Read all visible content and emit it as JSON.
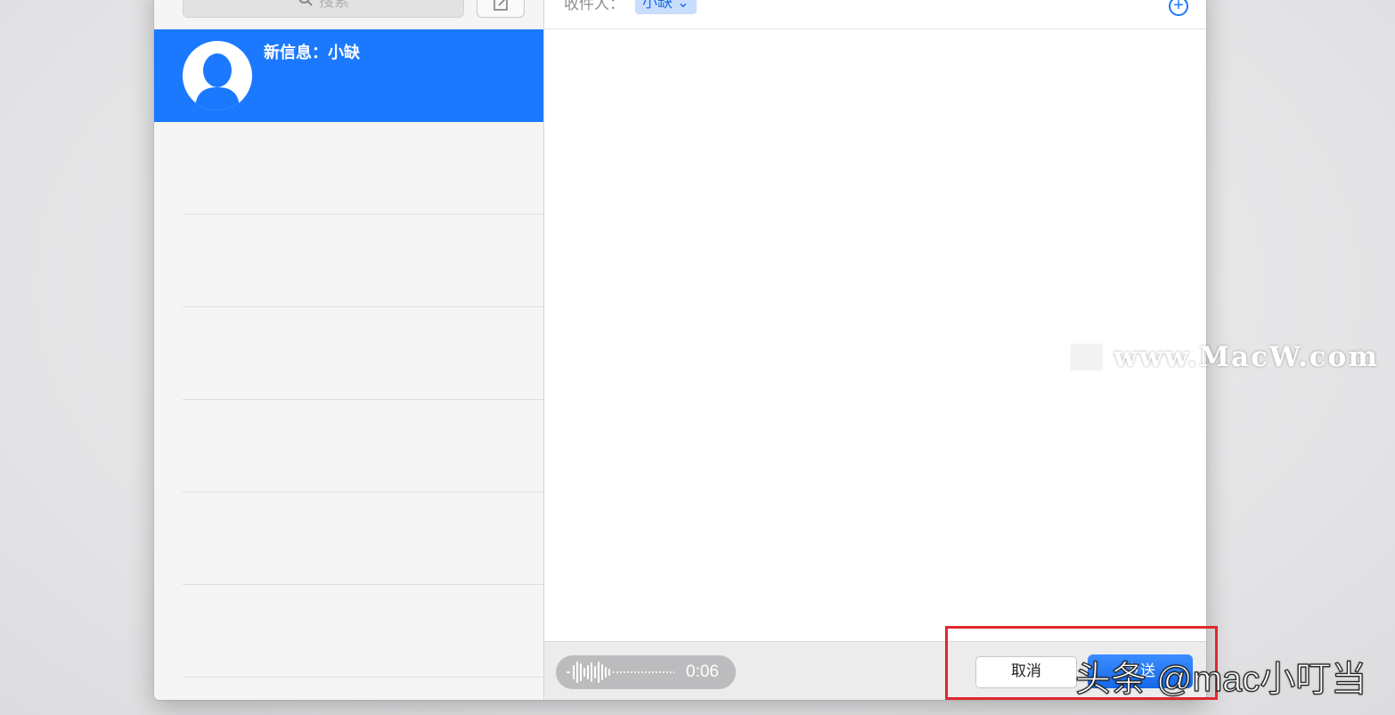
{
  "sidebar": {
    "search_placeholder": "搜索",
    "conversations": [
      {
        "title": "新信息：小缺",
        "selected": true
      }
    ]
  },
  "main": {
    "to_label": "收件人：",
    "recipient": "小缺 ⌄"
  },
  "bottom_bar": {
    "voice_duration": "0:06",
    "cancel_label": "取消",
    "send_label": "发送"
  },
  "watermarks": {
    "site": "www.MacW.com",
    "toutiao": "头条 @mac小叮当"
  },
  "colors": {
    "accent": "#1b79ff",
    "highlight_box": "#e0282e"
  }
}
